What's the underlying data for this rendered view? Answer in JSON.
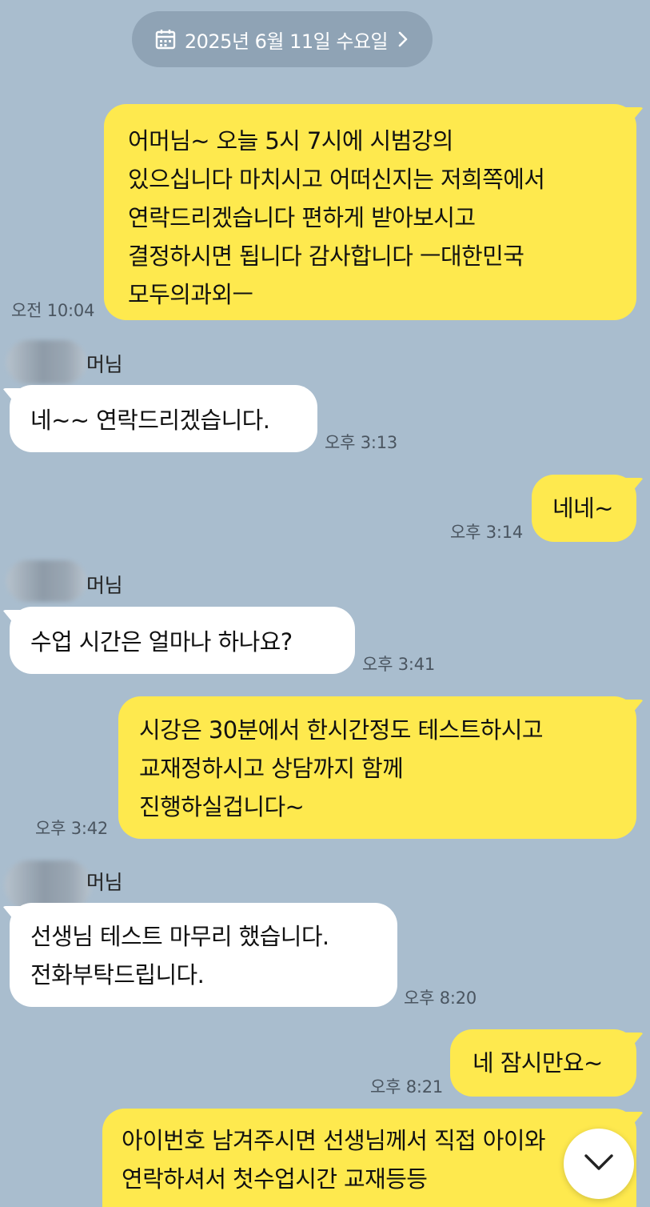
{
  "date_header": {
    "label": "2025년 6월 11일 수요일",
    "icon": "calendar-icon",
    "chevron": "chevron-right-icon"
  },
  "messages": [
    {
      "from": "me",
      "text": "어머님~ 오늘 5시 7시에 시범강의\n있으십니다 마치시고 어떠신지는 저희쪽에서\n연락드리겠습니다 편하게 받아보시고\n결정하시면 됩니다 감사합니다 ㅡ대한민국\n모두의과외ㅡ",
      "time": "오전 10:04"
    },
    {
      "from": "other",
      "sender": "머님",
      "text": "네~~ 연락드리겠습니다.",
      "time": "오후 3:13"
    },
    {
      "from": "me",
      "text": "네네~",
      "time": "오후 3:14"
    },
    {
      "from": "other",
      "sender": "머님",
      "text": "수업 시간은 얼마나 하나요?",
      "time": "오후 3:41"
    },
    {
      "from": "me",
      "text": "시강은 30분에서 한시간정도 테스트하시고\n교재정하시고 상담까지 함께\n진행하실겁니다~",
      "time": "오후 3:42"
    },
    {
      "from": "other",
      "sender": "머님",
      "text": "선생님 테스트 마무리 했습니다.\n전화부탁드립니다.",
      "time": "오후 8:20"
    },
    {
      "from": "me",
      "text": "네 잠시만요~",
      "time": "오후 8:21"
    },
    {
      "from": "me",
      "text": "아이번호 남겨주시면 선생님께서 직접 아이와\n연락하셔서 첫수업시간 교재등등",
      "time": ""
    }
  ],
  "scroll_button": {
    "icon": "chevron-down-icon"
  },
  "colors": {
    "background": "#a9bdce",
    "my_bubble": "#fee94e",
    "their_bubble": "#ffffff",
    "date_pill": "#8fa3b5"
  }
}
